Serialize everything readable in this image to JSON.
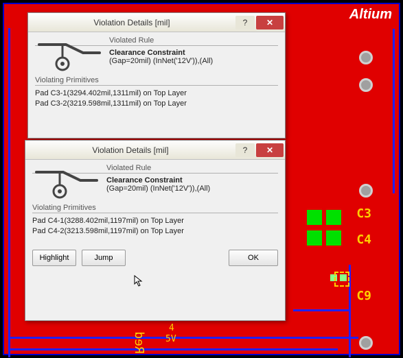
{
  "brand": "Altium",
  "pcb": {
    "labels": {
      "C3": "C3",
      "C4": "C4",
      "C9": "C9",
      "net_num": "4",
      "net_name": "5V",
      "mirror": "Red"
    }
  },
  "dialog1": {
    "title": "Violation Details [mil]",
    "help": "?",
    "close": "✕",
    "violated_rule_head": "Violated Rule",
    "rule_name": "Clearance Constraint",
    "rule_desc": "(Gap=20mil) (InNet('12V')),(All)",
    "violating_head": "Violating Primitives",
    "prim1": "Pad C3-1(3294.402mil,1311mil) on Top Layer",
    "prim2": "Pad C3-2(3219.598mil,1311mil) on Top Layer"
  },
  "dialog2": {
    "title": "Violation Details [mil]",
    "help": "?",
    "close": "✕",
    "violated_rule_head": "Violated Rule",
    "rule_name": "Clearance Constraint",
    "rule_desc": "(Gap=20mil) (InNet('12V')),(All)",
    "violating_head": "Violating Primitives",
    "prim1": "Pad C4-1(3288.402mil,1197mil) on Top Layer",
    "prim2": "Pad C4-2(3213.598mil,1197mil) on Top Layer",
    "btn_highlight": "Highlight",
    "btn_jump": "Jump",
    "btn_ok": "OK"
  }
}
